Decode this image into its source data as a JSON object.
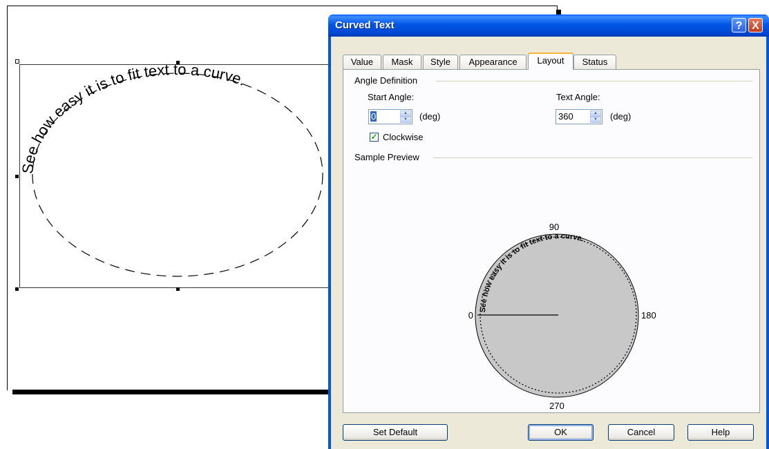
{
  "canvas": {
    "curved_text": "See how easy it is to fit text to a curve."
  },
  "dialog": {
    "title": "Curved Text",
    "help_glyph": "?",
    "close_glyph": "X",
    "tabs": [
      {
        "label": "Value"
      },
      {
        "label": "Mask"
      },
      {
        "label": "Style"
      },
      {
        "label": "Appearance"
      },
      {
        "label": "Layout",
        "active": true
      },
      {
        "label": "Status"
      }
    ],
    "layout": {
      "angle_group_label": "Angle Definition",
      "start_angle_label": "Start Angle:",
      "start_angle_value": "0",
      "text_angle_label": "Text Angle:",
      "text_angle_value": "360",
      "unit_label": "(deg)",
      "clockwise_label": "Clockwise",
      "clockwise_checked": true,
      "preview_group_label": "Sample Preview",
      "preview_text": "See how easy it is to fit text to a curve.",
      "dial_labels": {
        "top": "90",
        "left": "0",
        "right": "180",
        "bottom": "270"
      }
    },
    "buttons": {
      "set_default": "Set Default",
      "ok": "OK",
      "cancel": "Cancel",
      "help": "Help"
    }
  },
  "colors": {
    "title_bar": "#0054e3",
    "dialog_face": "#ece9d8",
    "preview_fill": "#c8c8c8",
    "tab_active_accent": "#f8b332"
  }
}
